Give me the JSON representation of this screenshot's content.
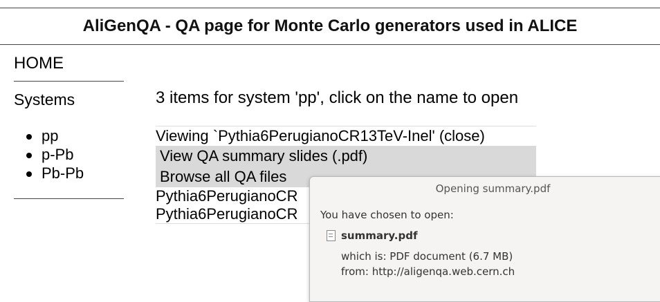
{
  "header": {
    "title": "AliGenQA - QA page for Monte Carlo generators used in ALICE"
  },
  "nav": {
    "home_label": "HOME",
    "systems_label": "Systems",
    "systems": [
      "pp",
      "p-Pb",
      "Pb-Pb"
    ]
  },
  "main": {
    "title": "3 items for system 'pp', click on the name to open",
    "viewing_prefix": "Viewing `Pythia6PerugianoCR13TeV-Inel'",
    "close_label": "(close)",
    "actions": [
      "View QA summary slides (.pdf)",
      "Browse all QA files"
    ],
    "items": [
      "Pythia6PerugianoCR",
      "Pythia6PerugianoCR"
    ]
  },
  "dialog": {
    "title": "Opening summary.pdf",
    "intro": "You have chosen to open:",
    "filename": "summary.pdf",
    "which_is": "which is: PDF document (6.7 MB)",
    "from": "from: http://aligenqa.web.cern.ch"
  }
}
